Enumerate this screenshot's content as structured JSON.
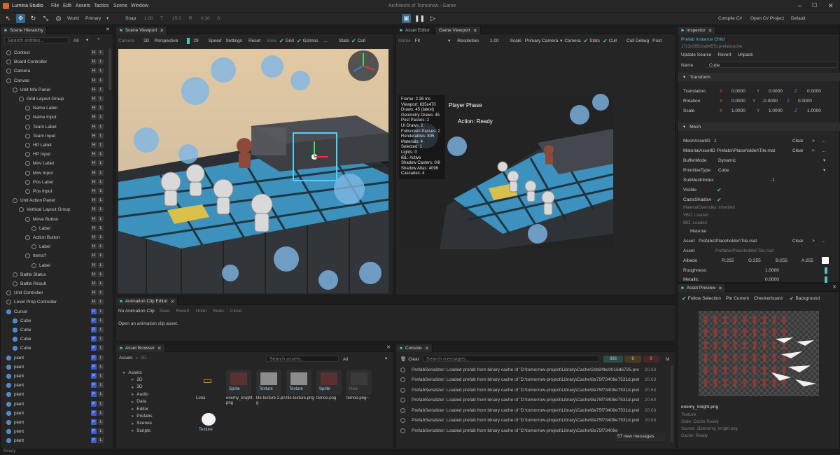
{
  "app": {
    "name": "Lumina Studio",
    "title": "Architects of Tomorrow - Game",
    "menu": [
      "File",
      "Edit",
      "Assets",
      "Tactics",
      "Scene",
      "Window"
    ],
    "right": [
      "Compile C#",
      "Open C# Project",
      "Default"
    ]
  },
  "toolbar": {
    "world": "World",
    "primary": "Primary",
    "snap": "Snap",
    "snap_val": "1.00",
    "t_label": "T",
    "t_val": "15.0",
    "r_label": "R",
    "r_val": "0.10",
    "s_label": "S"
  },
  "hierarchy": {
    "tab": "Scene Hierarchy",
    "search": "Search entities...",
    "filter": "All",
    "items": [
      {
        "label": "Context",
        "depth": 0,
        "blue": false
      },
      {
        "label": "Board Controller",
        "depth": 0,
        "blue": false
      },
      {
        "label": "Camera",
        "depth": 0,
        "blue": false
      },
      {
        "label": "Canvas",
        "depth": 0,
        "blue": false
      },
      {
        "label": "Unit Info Panel",
        "depth": 1,
        "blue": false
      },
      {
        "label": "Grid Layout Group",
        "depth": 2,
        "blue": false
      },
      {
        "label": "Name Label",
        "depth": 3,
        "blue": false
      },
      {
        "label": "Name Input",
        "depth": 3,
        "blue": false
      },
      {
        "label": "Team Label",
        "depth": 3,
        "blue": false
      },
      {
        "label": "Team Input",
        "depth": 3,
        "blue": false
      },
      {
        "label": "HP Label",
        "depth": 3,
        "blue": false
      },
      {
        "label": "HP Input",
        "depth": 3,
        "blue": false
      },
      {
        "label": "Mov Label",
        "depth": 3,
        "blue": false
      },
      {
        "label": "Mov Input",
        "depth": 3,
        "blue": false
      },
      {
        "label": "Pos Label",
        "depth": 3,
        "blue": false
      },
      {
        "label": "Pos Input",
        "depth": 3,
        "blue": false
      },
      {
        "label": "Unit Action Panel",
        "depth": 1,
        "blue": false
      },
      {
        "label": "Vertical Layout Group",
        "depth": 2,
        "blue": false
      },
      {
        "label": "Move Button",
        "depth": 3,
        "blue": false
      },
      {
        "label": "Label",
        "depth": 4,
        "blue": false
      },
      {
        "label": "Action Button",
        "depth": 3,
        "blue": false
      },
      {
        "label": "Label",
        "depth": 4,
        "blue": false
      },
      {
        "label": "Items?",
        "depth": 3,
        "blue": false
      },
      {
        "label": "Label",
        "depth": 4,
        "blue": false
      },
      {
        "label": "Battle Status",
        "depth": 1,
        "blue": false
      },
      {
        "label": "Battle Result",
        "depth": 1,
        "blue": false
      },
      {
        "label": "Unit Controller",
        "depth": 0,
        "blue": false
      },
      {
        "label": "Level Prop Controller",
        "depth": 0,
        "blue": false
      },
      {
        "label": "Cursor",
        "depth": 0,
        "blue": true
      },
      {
        "label": "Cube",
        "depth": 1,
        "blue": true
      },
      {
        "label": "Cube",
        "depth": 1,
        "blue": true
      },
      {
        "label": "Cube",
        "depth": 1,
        "blue": true
      },
      {
        "label": "Cube",
        "depth": 1,
        "blue": true
      },
      {
        "label": "plant",
        "depth": 0,
        "blue": true
      },
      {
        "label": "plant",
        "depth": 0,
        "blue": true
      },
      {
        "label": "plant",
        "depth": 0,
        "blue": true
      },
      {
        "label": "plant",
        "depth": 0,
        "blue": true
      },
      {
        "label": "plant",
        "depth": 0,
        "blue": true
      },
      {
        "label": "plant",
        "depth": 0,
        "blue": true
      },
      {
        "label": "plant",
        "depth": 0,
        "blue": true
      },
      {
        "label": "plant",
        "depth": 0,
        "blue": true
      },
      {
        "label": "plant",
        "depth": 0,
        "blue": true
      },
      {
        "label": "plant",
        "depth": 0,
        "blue": true
      }
    ],
    "h": "H",
    "l": "L",
    "p": "P"
  },
  "sceneview": {
    "tab": "Scene Viewport",
    "camera": "Camera",
    "mode2d": "2D",
    "perspective": "Perspective",
    "num": "29",
    "speed": "Speed",
    "settings": "Settings",
    "reset": "Reset",
    "view": "View",
    "grid": "Grid",
    "gizmos": "Gizmos",
    "more": "...",
    "stats": "Stats",
    "cull": "Cull"
  },
  "gameview": {
    "tab_asset": "Asset Editor",
    "tab": "Game Viewport",
    "game": "Game",
    "fit": "Fit",
    "resolution": "Resolution",
    "res_val": "1.00",
    "scale": "Scale",
    "primary_camera": "Primary Camera",
    "camera": "Camera",
    "stats": "Stats",
    "cull": "Cull",
    "cull_debug": "Cull Debug",
    "post": "Post",
    "stats_lines": [
      "Frame: 2.36 ms",
      "Viewport: 835x470",
      "Draws: 45 (latest)",
      "Geometry Draws: 45",
      "Post Passes: 2",
      "UI Draws: 2",
      "Fullscreen Passes: 2",
      "Renderables: 805",
      "Materials: 4",
      "Selected: 1",
      "Lights: 0",
      "IBL: Active",
      "Shadow Casters: 0/8",
      "Shadow Atlas: 4096",
      "Cascades: 4"
    ],
    "hud1": "Player  Phase",
    "hud2": "Action:  Ready"
  },
  "anim": {
    "tab": "Animation Clip Editor",
    "no_clip": "No Animation Clip",
    "save": "Save",
    "revert": "Revert",
    "undo": "Undo",
    "redo": "Redo",
    "close": "Close",
    "msg": "Open an animation clip asset."
  },
  "assetbrowser": {
    "tab": "Asset Browser",
    "path1": "Assets",
    "path2": "2D",
    "search": "Search assets...",
    "filter": "All",
    "tree": [
      {
        "label": "Assets",
        "d": 0
      },
      {
        "label": "2D",
        "d": 1
      },
      {
        "label": "3D",
        "d": 1
      },
      {
        "label": "Audio",
        "d": 1
      },
      {
        "label": "Data",
        "d": 1
      },
      {
        "label": "Editor",
        "d": 1
      },
      {
        "label": "Prefabs",
        "d": 1
      },
      {
        "label": "Scenes",
        "d": 1
      },
      {
        "label": "Scripts",
        "d": 1
      }
    ],
    "tiles": [
      {
        "badge": "",
        "name": "Luna"
      },
      {
        "badge": "Sprite",
        "name": "enemy_knight.png"
      },
      {
        "badge": "Texture",
        "name": "tile-texture-2.png"
      },
      {
        "badge": "Texture",
        "name": "tile-texture.png"
      },
      {
        "badge": "Sprite",
        "name": "tomoo.png"
      },
      {
        "badge": "Raw",
        "name": "tomoo.png~"
      },
      {
        "badge": "Texture",
        "name": ""
      }
    ]
  },
  "console": {
    "tab": "Console",
    "clear": "Clear",
    "search": "Search messages...",
    "count1": "896",
    "count2": "6",
    "count3": "0",
    "m": "M",
    "rows": [
      {
        "msg": "PrefabSerializer: Loaded prefab from binary cache of 'D:\\tomorrow-project\\Library\\Cache\\2cb84bc0016d6725.prefab'",
        "t": "20.63"
      },
      {
        "msg": "PrefabSerializer: Loaded prefab from binary cache of 'D:\\tomorrow-project\\Library\\Cache\\8a75f73408e7531d.prefab'",
        "t": "20.63"
      },
      {
        "msg": "PrefabSerializer: Loaded prefab from binary cache of 'D:\\tomorrow-project\\Library\\Cache\\8a75f73408e7531d.prefab'",
        "t": "20.63"
      },
      {
        "msg": "PrefabSerializer: Loaded prefab from binary cache of 'D:\\tomorrow-project\\Library\\Cache\\8a75f73408e7531d.prefab'",
        "t": "20.63"
      },
      {
        "msg": "PrefabSerializer: Loaded prefab from binary cache of 'D:\\tomorrow-project\\Library\\Cache\\8a75f73408e7531d.prefab'",
        "t": "20.63"
      },
      {
        "msg": "PrefabSerializer: Loaded prefab from binary cache of 'D:\\tomorrow-project\\Library\\Cache\\8a75f73408e7531d.prefab'",
        "t": "20.63"
      },
      {
        "msg": "PrefabSerializer: Loaded prefab from binary cache of 'D:\\tomorrow-project\\Library\\Cache\\8a75f73408e",
        "t": ""
      }
    ],
    "new_msgs": "57 new messages"
  },
  "inspector": {
    "tab": "Inspector",
    "prefab": "Prefab Instance Child",
    "guid": "17c3c885c8a8457d.prefabcache",
    "update": "Update Source",
    "revert": "Revert",
    "unpack": "Unpack",
    "name_label": "Name",
    "name_val": "Cube",
    "transform": "Transform",
    "translation": "Translation",
    "rotation": "Rotation",
    "scale": "Scale",
    "x": "X",
    "y": "Y",
    "z": "Z",
    "t_vals": [
      "0.0000",
      "0.0000",
      "0.0000"
    ],
    "r_vals": [
      "0.0000",
      "-0.0000",
      "0.0000"
    ],
    "s_vals": [
      "1.0000",
      "1.0000",
      "1.0000"
    ],
    "mesh": "Mesh",
    "mesh_asset_id": "MeshAssetID",
    "mesh_asset_val": "1",
    "clear": "Clear",
    "arrow": ">",
    "dots": "...",
    "material_asset_id": "MaterialAssetID",
    "material_path": "Prefabs\\Placeholder\\Tile.mat",
    "buffer_mode": "BufferMode",
    "buffer_val": "Dynamic",
    "primitive": "PrimitiveType",
    "primitive_val": "Cube",
    "submesh": "SubMeshIndex",
    "submesh_val": "-1",
    "visible": "Visible",
    "casts_shadow": "CastsShadow",
    "overrides": "MaterialOverrides: inherited",
    "vbo": "VBO: Loaded",
    "ibo": "IBO: Loaded",
    "material": "Material",
    "asset": "Asset",
    "asset_path": "Prefabs\\Placeholder\\Tile.mat",
    "asset_path2": "Prefabs\\Placeholder\\Tile.mat",
    "albedo": "Albedo",
    "r": "R:255",
    "g": "G:255",
    "b": "B:255",
    "a": "A:255",
    "roughness": "Roughness",
    "roughness_val": "1.0000",
    "metallic": "Metallic",
    "metallic_val": "0.0000"
  },
  "preview": {
    "tab": "Asset Preview",
    "follow": "Follow Selection",
    "pin": "Pin Current",
    "checker": "Checkerboard",
    "background": "Background",
    "file": "enemy_knight.png",
    "type": "Texture",
    "state": "State: Cache Ready",
    "source": "Source: 2D/enemy_knight.png",
    "cache": "Cache: Ready"
  },
  "status": "Ready"
}
